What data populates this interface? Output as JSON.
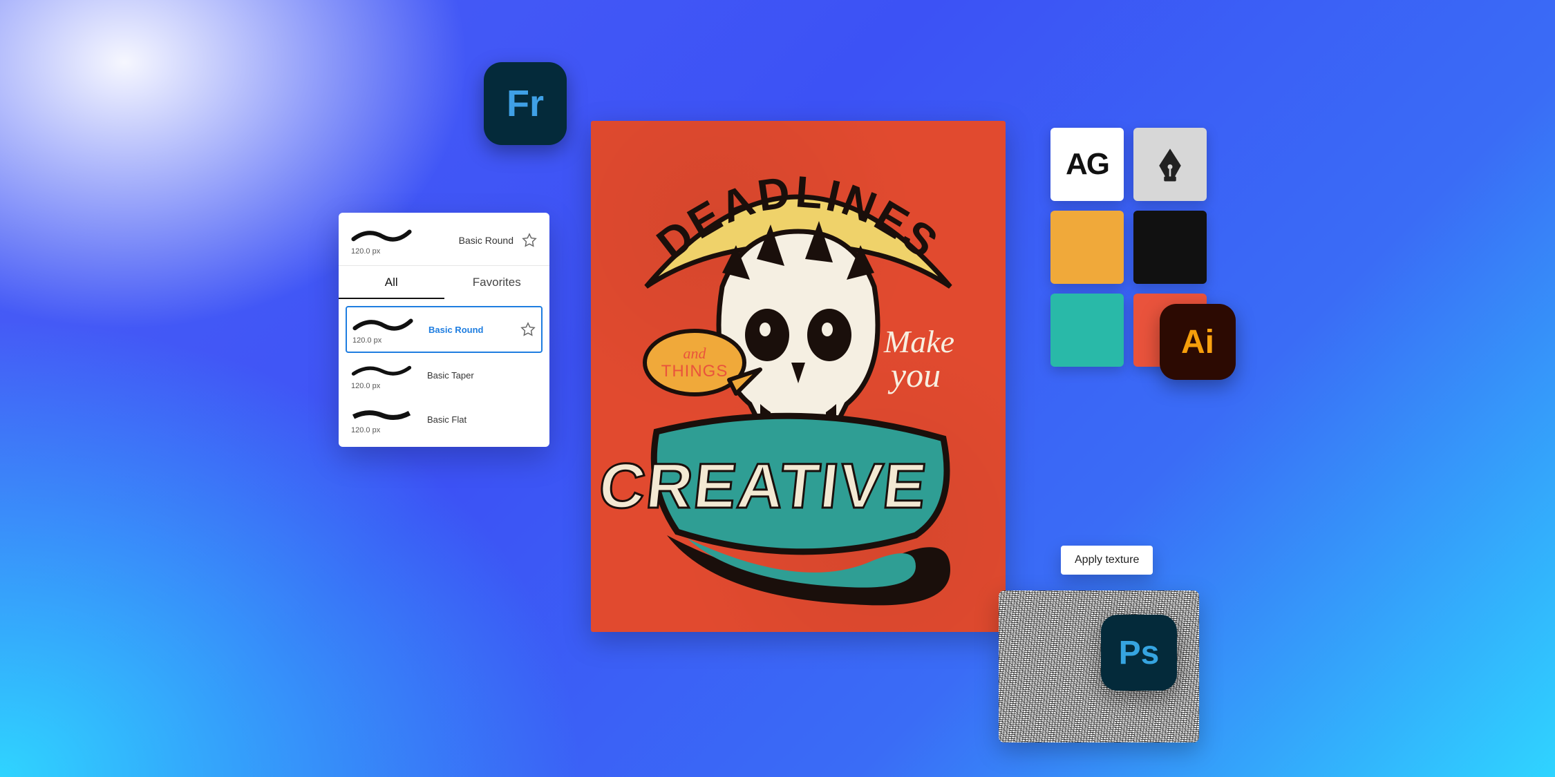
{
  "apps": {
    "fresco": {
      "glyph1": "F",
      "glyph2": "r"
    },
    "illustrator": {
      "glyph1": "A",
      "glyph2": "i"
    },
    "photoshop": {
      "glyph1": "P",
      "glyph2": "s"
    }
  },
  "brush_panel": {
    "header_brush": {
      "name": "Basic Round",
      "size": "120.0 px"
    },
    "tabs": {
      "all": "All",
      "favorites": "Favorites",
      "active": "all"
    },
    "brushes": [
      {
        "name": "Basic Round",
        "size": "120.0 px",
        "selected": true
      },
      {
        "name": "Basic Taper",
        "size": "120.0 px",
        "selected": false
      },
      {
        "name": "Basic Flat",
        "size": "120.0 px",
        "selected": false
      }
    ]
  },
  "swatches": {
    "type_label": "AG",
    "colors": {
      "orange": "#f0a93a",
      "black": "#111111",
      "teal": "#29b9a8",
      "red": "#e9533c"
    }
  },
  "tooltip": {
    "apply_texture": "Apply texture"
  },
  "poster": {
    "word_top": "DEADLINES",
    "bubble_line1": "and",
    "bubble_line2": "THINGS",
    "script_line1": "Make",
    "script_line2": "you",
    "word_bottom": "CREATIVE"
  }
}
